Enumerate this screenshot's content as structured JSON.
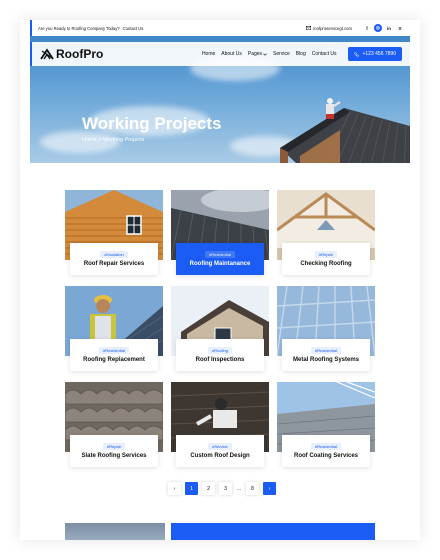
{
  "topbar": {
    "promo": "Are you Ready to Roofing Company Today?",
    "contact_link": "Contact Us",
    "email": "roofproservicegt.com",
    "socials": [
      {
        "icon": "facebook-icon",
        "glyph": "f"
      },
      {
        "icon": "instagram-icon",
        "glyph": "◎"
      },
      {
        "icon": "linkedin-icon",
        "glyph": "in"
      },
      {
        "icon": "x-icon",
        "glyph": "X"
      }
    ]
  },
  "header": {
    "logo_text": "RoofPro",
    "nav": [
      "Home",
      "About Us",
      "Pages",
      "Service",
      "Blog",
      "Contact Us"
    ],
    "phone": "+123 456 7890"
  },
  "hero": {
    "title": "Working Projects",
    "breadcrumb": "Home > Working Projects"
  },
  "projects": [
    {
      "tag": "#Insulation",
      "title": "Roof Repair Services",
      "active": false,
      "img": "wood-cabin"
    },
    {
      "tag": "#Residential",
      "title": "Roofing Maintanance",
      "active": true,
      "img": "metal-roof-clouds"
    },
    {
      "tag": "#Repair",
      "title": "Checking Roofing",
      "active": false,
      "img": "attic-beams"
    },
    {
      "tag": "#Residential",
      "title": "Roofing Replacement",
      "active": false,
      "img": "worker-helmet"
    },
    {
      "tag": "#Roofing",
      "title": "Roof Inspections",
      "active": false,
      "img": "house-gable"
    },
    {
      "tag": "#Residential",
      "title": "Metal Roofing Systems",
      "active": false,
      "img": "glass-roof"
    },
    {
      "tag": "#Repair",
      "title": "Slate Roofing Services",
      "active": false,
      "img": "clay-tiles"
    },
    {
      "tag": "#Service",
      "title": "Custom Roof Design",
      "active": false,
      "img": "worker-tiles"
    },
    {
      "tag": "#Residential",
      "title": "Roof Coating Services",
      "active": false,
      "img": "modern-roof"
    }
  ],
  "pagination": {
    "prev": "‹",
    "pages": [
      "1",
      "2",
      "3",
      "...",
      "8"
    ],
    "next": "›",
    "current": "1"
  },
  "colors": {
    "accent": "#1b5cf5",
    "text": "#111111",
    "tag_bg": "#e7eefc"
  }
}
